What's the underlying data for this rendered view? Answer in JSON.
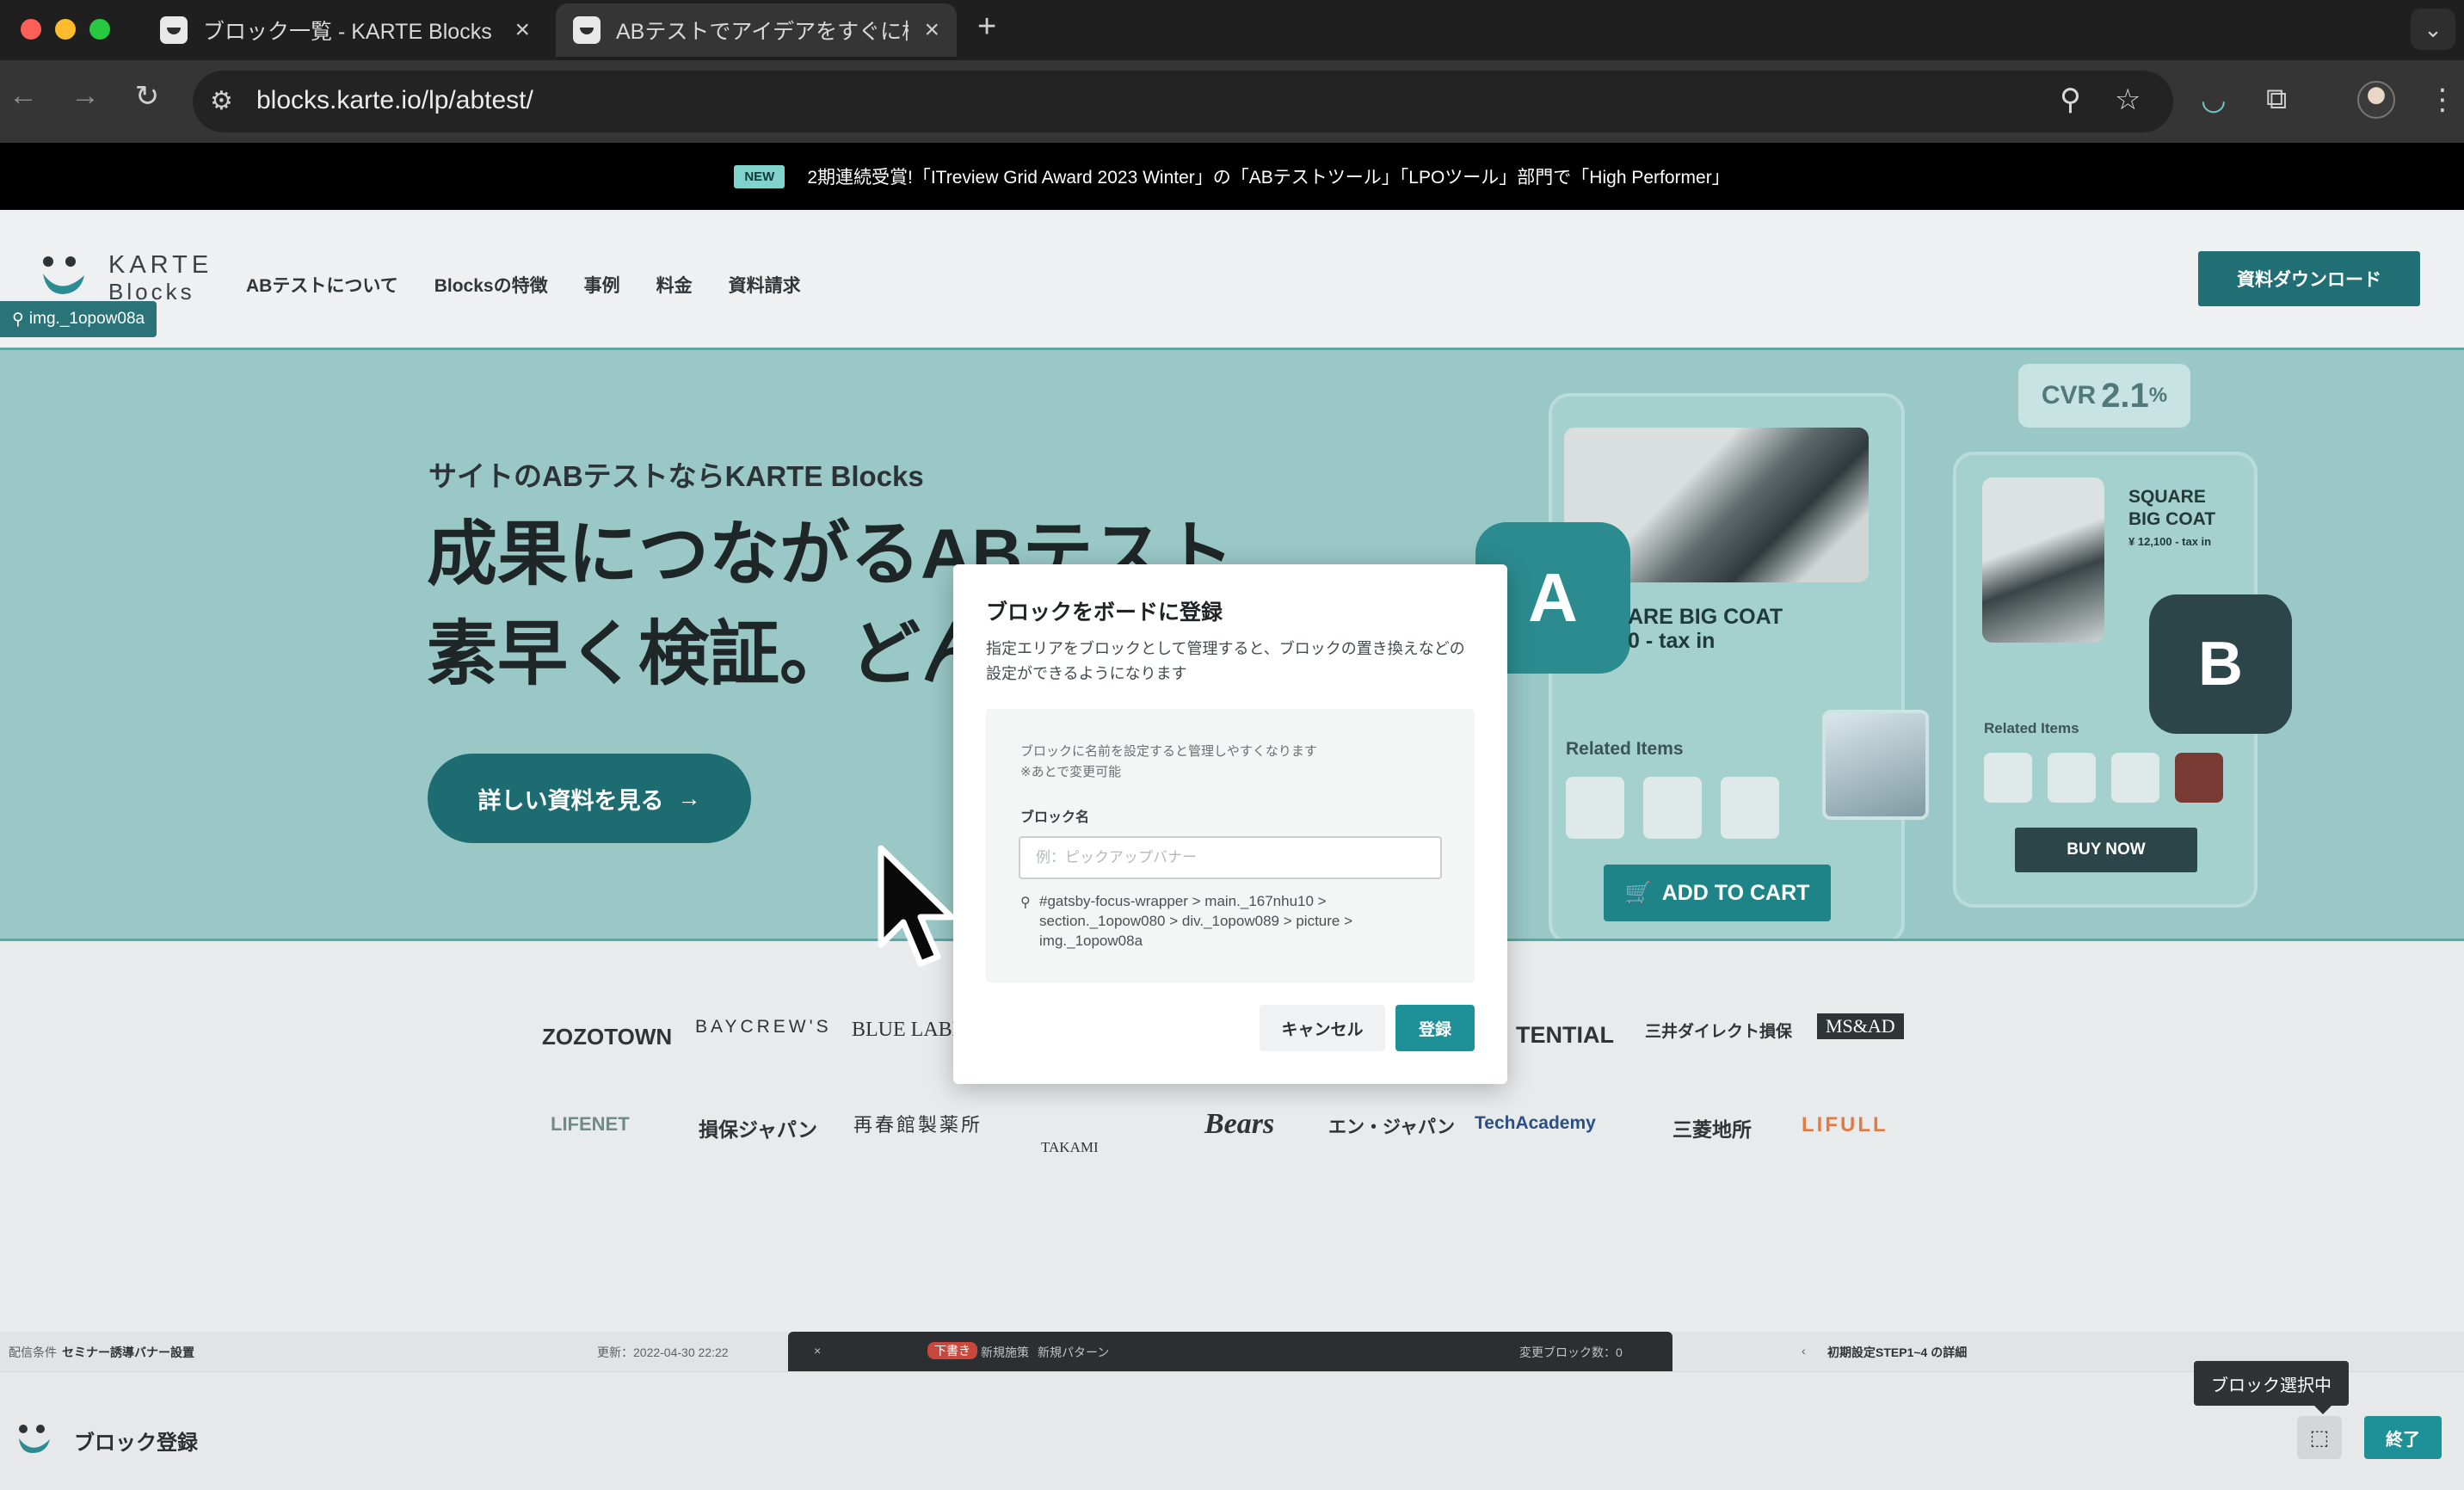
{
  "browser": {
    "tabs": [
      {
        "title": "ブロック一覧 - KARTE Blocks",
        "active": false
      },
      {
        "title": "ABテストでアイデアをすぐに検証",
        "active": true
      }
    ],
    "url": "blocks.karte.io/lp/abtest/",
    "icons": {
      "back": "back-arrow-icon",
      "forward": "forward-arrow-icon",
      "reload": "reload-icon",
      "zoom": "zoom-icon",
      "bookmark": "star-icon",
      "extensions": "puzzle-icon",
      "menu": "more-vert-icon"
    }
  },
  "announcement": {
    "badge": "NEW",
    "text": "2期連続受賞!「ITreview Grid Award 2023 Winter」の「ABテストツール」「LPOツール」部門で「High Performer」"
  },
  "site_header": {
    "logo_line1": "KARTE",
    "logo_line2": "Blocks",
    "nav": [
      "ABテストについて",
      "Blocksの特徴",
      "事例",
      "料金",
      "資料請求"
    ],
    "download_button": "資料ダウンロード",
    "selection_tag": "img._1opow08a"
  },
  "hero": {
    "subtitle": "サイトのABテストならKARTE Blocks",
    "headline_line1": "成果につながるABテスト",
    "headline_line2": "素早く検証。どん",
    "cta": "詳しい資料を見る",
    "mock": {
      "badge_a": "A",
      "badge_b": "B",
      "coat_a_line1": "ARE BIG COAT",
      "coat_a_line2": "0 - tax in",
      "related_items": "Related Items",
      "add_to_cart": "ADD TO CART",
      "cvr_label": "CVR",
      "cvr_value": "2.1",
      "cvr_unit": "%",
      "coat_b_line1": "SQUARE",
      "coat_b_line2": "BIG COAT",
      "coat_b_price": "¥ 12,100 - tax in",
      "buy_now": "BUY NOW"
    }
  },
  "logos_row1": [
    "ZOZOTOWN",
    "BAYCREW'S",
    "BLUE LABEL",
    "TENTIAL",
    "三井ダイレクト損保",
    "MS&AD"
  ],
  "logos_row2": [
    "LIFENET",
    "損保ジャパン",
    "再春館製薬所",
    "TAKAMI",
    "Bears",
    "エン・ジャパン",
    "TechAcademy",
    "三菱地所",
    "LIFULL"
  ],
  "modal": {
    "title": "ブロックをボードに登録",
    "description": "指定エリアをブロックとして管理すると、ブロックの置き換えなどの設定ができるようになります",
    "note_line1": "ブロックに名前を設定すると管理しやすくなります",
    "note_line2": "※あとで変更可能",
    "field_label": "ブロック名",
    "field_placeholder": "例：ピックアップバナー",
    "field_value": "",
    "selector_path": "#gatsby-focus-wrapper > main._167nhu10 > section._1opow080 > div._1opow089 > picture > img._1opow08a",
    "cancel": "キャンセル",
    "register": "登録"
  },
  "bottom_strip": {
    "left_label": "配信条件",
    "left_title": "セミナー誘導バナー設置",
    "left_date": "更新：2022-04-30 22:22",
    "center_tag": "下書き",
    "center_name": "新規施策",
    "center_pattern": "新規パターン",
    "center_changes": "変更ブロック数：0",
    "right_title": "初期設定STEP1~4 の詳細"
  },
  "bottom_bar": {
    "title": "ブロック登録",
    "tooltip": "ブロック選択中",
    "end_button": "終了"
  },
  "colors": {
    "accent": "#1e9097",
    "brand_dark": "#1f6f74",
    "hero_bg": "#99c8c6"
  }
}
